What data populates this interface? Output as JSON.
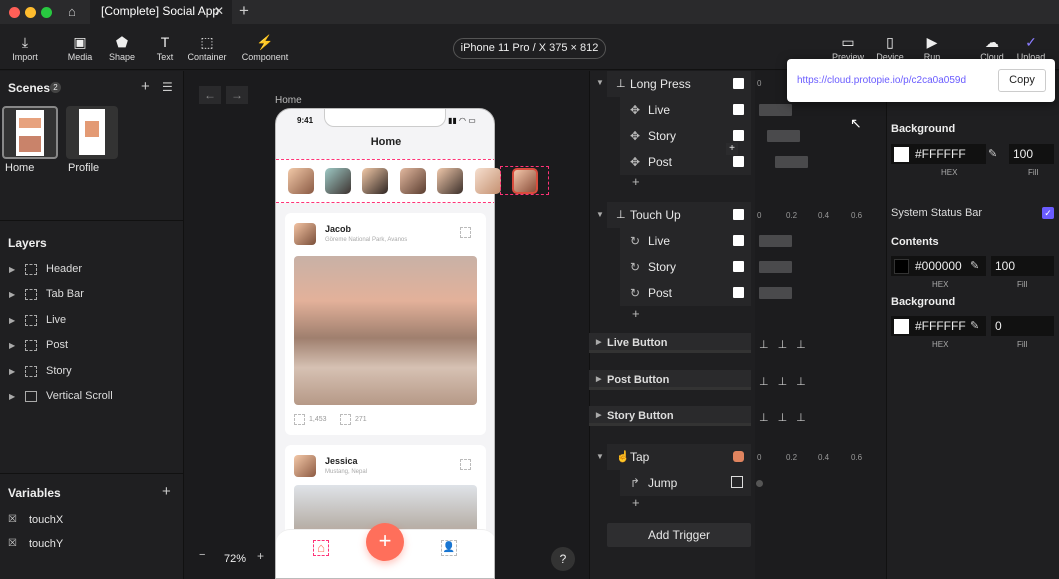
{
  "app": {
    "tab_title": "[Complete] Social App",
    "device": "iPhone 11 Pro / X  375 × 812"
  },
  "toolbar": {
    "import": "Import",
    "media": "Media",
    "shape": "Shape",
    "text": "Text",
    "container": "Container",
    "component": "Component",
    "preview": "Preview",
    "device": "Device",
    "run": "Run",
    "cloud": "Cloud",
    "upload": "Upload"
  },
  "scenes": {
    "title": "Scenes",
    "count": "2",
    "items": [
      "Home",
      "Profile"
    ]
  },
  "layers": {
    "title": "Layers",
    "items": [
      "Header",
      "Tab Bar",
      "Live",
      "Post",
      "Story",
      "Vertical Scroll"
    ]
  },
  "variables": {
    "title": "Variables",
    "items": [
      "touchX",
      "touchY"
    ]
  },
  "canvas": {
    "frame_label": "Home",
    "zoom": "72%",
    "help": "?"
  },
  "phone": {
    "time": "9:41",
    "header": "Home",
    "posts": [
      {
        "name": "Jacob",
        "location": "Göreme National Park, Avanos",
        "likes": "1,453",
        "comments": "271"
      },
      {
        "name": "Jessica",
        "location": "Mustang, Nepal"
      }
    ]
  },
  "timeline": {
    "long_press": {
      "label": "Long Press",
      "rows": [
        "Live",
        "Story",
        "Post"
      ]
    },
    "touch_up": {
      "label": "Touch Up",
      "rows": [
        "Live",
        "Story",
        "Post"
      ]
    },
    "groups": [
      "Live Button",
      "Post Button",
      "Story Button"
    ],
    "tap": {
      "label": "Tap",
      "jump": "Jump"
    },
    "add_trigger": "Add Trigger",
    "ticks": [
      "0",
      "0.2",
      "0.4",
      "0.6"
    ],
    "plus": "+"
  },
  "share": {
    "url": "https://cloud.protopie.io/p/c2ca0a059d",
    "copy": "Copy"
  },
  "props": {
    "background1": {
      "title": "Background",
      "hex": "#FFFFFF",
      "fill": "100",
      "hex_label": "HEX",
      "fill_label": "Fill"
    },
    "status_bar": "System Status Bar",
    "contents": {
      "title": "Contents",
      "hex": "#000000",
      "fill": "100",
      "hex_label": "HEX",
      "fill_label": "Fill"
    },
    "background2": {
      "title": "Background",
      "hex": "#FFFFFF",
      "fill": "0",
      "hex_label": "HEX",
      "fill_label": "Fill"
    }
  },
  "colors": {
    "accent": "#ff6f5b",
    "link": "#8a7cff",
    "check": "#6a5cff"
  }
}
